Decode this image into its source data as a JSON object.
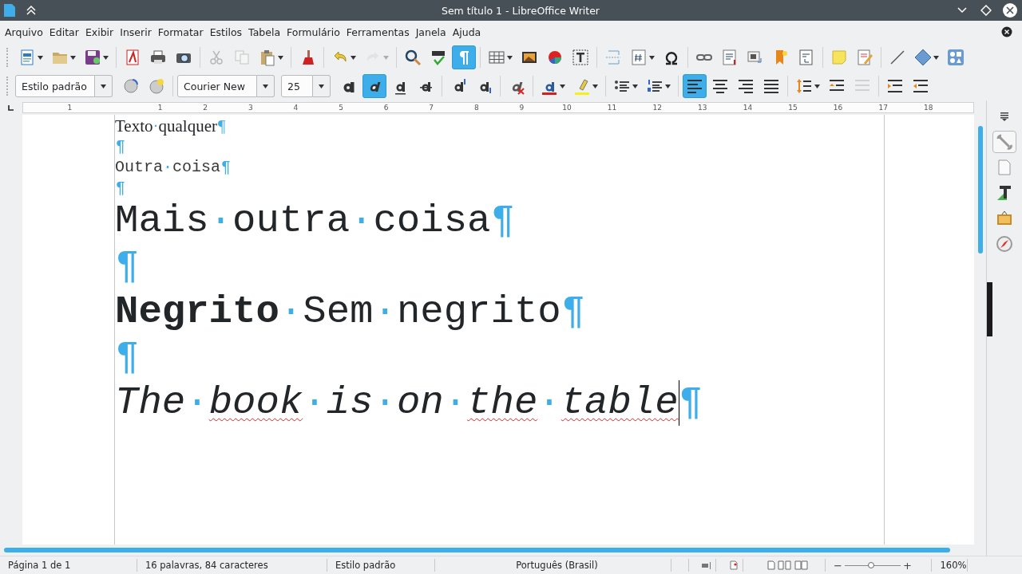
{
  "window": {
    "title": "Sem título 1 - LibreOffice Writer"
  },
  "menu": [
    "Arquivo",
    "Editar",
    "Exibir",
    "Inserir",
    "Formatar",
    "Estilos",
    "Tabela",
    "Formulário",
    "Ferramentas",
    "Janela",
    "Ajuda"
  ],
  "toolbar_standard": [
    {
      "kind": "new",
      "dropdown": true,
      "disabled": false,
      "selected": false
    },
    {
      "kind": "open",
      "dropdown": true,
      "disabled": false,
      "selected": false
    },
    {
      "kind": "save",
      "dropdown": true,
      "disabled": false,
      "selected": false
    },
    {
      "kind": "sep"
    },
    {
      "kind": "pdf",
      "dropdown": false,
      "disabled": false,
      "selected": false
    },
    {
      "kind": "print",
      "dropdown": false,
      "disabled": false,
      "selected": false
    },
    {
      "kind": "preview",
      "dropdown": false,
      "disabled": false,
      "selected": false
    },
    {
      "kind": "sep"
    },
    {
      "kind": "cut",
      "dropdown": false,
      "disabled": true,
      "selected": false
    },
    {
      "kind": "copy",
      "dropdown": false,
      "disabled": true,
      "selected": false
    },
    {
      "kind": "paste",
      "dropdown": true,
      "disabled": false,
      "selected": false
    },
    {
      "kind": "sep"
    },
    {
      "kind": "clone",
      "dropdown": false,
      "disabled": false,
      "selected": false
    },
    {
      "kind": "sep"
    },
    {
      "kind": "undo",
      "dropdown": true,
      "disabled": false,
      "selected": false
    },
    {
      "kind": "redo",
      "dropdown": true,
      "disabled": true,
      "selected": false
    },
    {
      "kind": "sep"
    },
    {
      "kind": "find",
      "dropdown": false,
      "disabled": false,
      "selected": false
    },
    {
      "kind": "spelling",
      "dropdown": false,
      "disabled": false,
      "selected": false
    },
    {
      "kind": "marks",
      "dropdown": false,
      "disabled": false,
      "selected": true
    },
    {
      "kind": "sep"
    },
    {
      "kind": "table",
      "dropdown": true,
      "disabled": false,
      "selected": false
    },
    {
      "kind": "image",
      "dropdown": false,
      "disabled": false,
      "selected": false
    },
    {
      "kind": "chart",
      "dropdown": false,
      "disabled": false,
      "selected": false
    },
    {
      "kind": "textbox",
      "dropdown": false,
      "disabled": false,
      "selected": false
    },
    {
      "kind": "sep"
    },
    {
      "kind": "pagebreak",
      "dropdown": false,
      "disabled": false,
      "selected": false
    },
    {
      "kind": "field",
      "dropdown": true,
      "disabled": false,
      "selected": false
    },
    {
      "kind": "special",
      "dropdown": false,
      "disabled": false,
      "selected": false
    },
    {
      "kind": "sep"
    },
    {
      "kind": "hyperlink",
      "dropdown": false,
      "disabled": false,
      "selected": false
    },
    {
      "kind": "footnote",
      "dropdown": false,
      "disabled": false,
      "selected": false
    },
    {
      "kind": "caption",
      "dropdown": false,
      "disabled": false,
      "selected": false
    },
    {
      "kind": "bookmark",
      "dropdown": false,
      "disabled": false,
      "selected": false
    },
    {
      "kind": "crossref",
      "dropdown": false,
      "disabled": false,
      "selected": false
    },
    {
      "kind": "sep"
    },
    {
      "kind": "comment",
      "dropdown": false,
      "disabled": false,
      "selected": false
    },
    {
      "kind": "track",
      "dropdown": false,
      "disabled": false,
      "selected": false
    },
    {
      "kind": "sep"
    },
    {
      "kind": "line",
      "dropdown": false,
      "disabled": false,
      "selected": false
    },
    {
      "kind": "shape",
      "dropdown": true,
      "disabled": false,
      "selected": false
    },
    {
      "kind": "shapes",
      "dropdown": false,
      "disabled": false,
      "selected": false
    }
  ],
  "paragraph_style": {
    "value": "Estilo padrão"
  },
  "font_name": {
    "value": "Courier New"
  },
  "font_size": {
    "value": "25"
  },
  "toolbar_formatting": [
    {
      "kind": "bold",
      "dropdown": false,
      "disabled": false,
      "selected": false
    },
    {
      "kind": "italic",
      "dropdown": false,
      "disabled": false,
      "selected": true
    },
    {
      "kind": "underline",
      "dropdown": false,
      "disabled": false,
      "selected": false
    },
    {
      "kind": "strike",
      "dropdown": false,
      "disabled": false,
      "selected": false
    },
    {
      "kind": "sep"
    },
    {
      "kind": "superscript",
      "dropdown": false,
      "disabled": false,
      "selected": false
    },
    {
      "kind": "subscript",
      "dropdown": false,
      "disabled": false,
      "selected": false
    },
    {
      "kind": "sep"
    },
    {
      "kind": "clear",
      "dropdown": false,
      "disabled": false,
      "selected": false
    },
    {
      "kind": "sep"
    },
    {
      "kind": "fontcolor",
      "dropdown": true,
      "disabled": false,
      "selected": false
    },
    {
      "kind": "highlight",
      "dropdown": true,
      "disabled": false,
      "selected": false
    },
    {
      "kind": "sep"
    },
    {
      "kind": "bullets",
      "dropdown": true,
      "disabled": false,
      "selected": false
    },
    {
      "kind": "numbering",
      "dropdown": true,
      "disabled": false,
      "selected": false
    },
    {
      "kind": "sep"
    },
    {
      "kind": "left",
      "dropdown": false,
      "disabled": false,
      "selected": true
    },
    {
      "kind": "center",
      "dropdown": false,
      "disabled": false,
      "selected": false
    },
    {
      "kind": "right",
      "dropdown": false,
      "disabled": false,
      "selected": false
    },
    {
      "kind": "justify",
      "dropdown": false,
      "disabled": false,
      "selected": false
    },
    {
      "kind": "sep"
    },
    {
      "kind": "spacing",
      "dropdown": true,
      "disabled": false,
      "selected": false
    },
    {
      "kind": "parainc",
      "dropdown": false,
      "disabled": false,
      "selected": false
    },
    {
      "kind": "paradec",
      "dropdown": false,
      "disabled": true,
      "selected": false
    },
    {
      "kind": "sep"
    },
    {
      "kind": "indentinc",
      "dropdown": false,
      "disabled": false,
      "selected": false
    },
    {
      "kind": "indentdec",
      "dropdown": false,
      "disabled": false,
      "selected": false
    }
  ],
  "ruler": [
    "1",
    "1",
    "2",
    "3",
    "4",
    "5",
    "6",
    "7",
    "8",
    "9",
    "10",
    "11",
    "12",
    "13",
    "14",
    "15",
    "16",
    "17",
    "18"
  ],
  "document": {
    "space_mark": "·",
    "paragraph_mark": "¶",
    "paragraphs": [
      {
        "kind": "serif-small",
        "words": [
          {
            "text": "Texto",
            "bold": false,
            "misspelled": false
          },
          {
            "text": "qualquer",
            "bold": false,
            "misspelled": false
          }
        ],
        "cursor": false
      },
      {
        "kind": "mono-small",
        "cursor": false
      },
      {
        "kind": "mono-small",
        "words": [
          {
            "text": "Outra",
            "bold": false,
            "misspelled": false
          },
          {
            "text": "coisa",
            "bold": false,
            "misspelled": false
          }
        ],
        "cursor": false
      },
      {
        "kind": "mono-small",
        "cursor": false
      },
      {
        "kind": "mono-large",
        "words": [
          {
            "text": "Mais",
            "bold": false,
            "misspelled": false
          },
          {
            "text": "outra",
            "bold": false,
            "misspelled": false
          },
          {
            "text": "coisa",
            "bold": false,
            "misspelled": false
          }
        ],
        "cursor": false
      },
      {
        "kind": "mono-large",
        "cursor": false
      },
      {
        "kind": "mono-large",
        "words": [
          {
            "text": "Negrito",
            "bold": true,
            "misspelled": false
          },
          {
            "text": "Sem",
            "bold": false,
            "misspelled": false
          },
          {
            "text": "negrito",
            "bold": false,
            "misspelled": false
          }
        ],
        "cursor": false
      },
      {
        "kind": "mono-large",
        "cursor": false
      },
      {
        "kind": "mono-large-italic",
        "words": [
          {
            "text": "The",
            "bold": false,
            "misspelled": false
          },
          {
            "text": "book",
            "bold": false,
            "misspelled": true
          },
          {
            "text": "is",
            "bold": false,
            "misspelled": false
          },
          {
            "text": "on",
            "bold": false,
            "misspelled": false
          },
          {
            "text": "the",
            "bold": false,
            "misspelled": true
          },
          {
            "text": "table",
            "bold": false,
            "misspelled": true
          }
        ],
        "cursor": true
      }
    ]
  },
  "sidebar": [
    {
      "kind": "menu",
      "selected": false
    },
    {
      "kind": "properties",
      "selected": true
    },
    {
      "kind": "page",
      "selected": false
    },
    {
      "kind": "styles",
      "selected": false
    },
    {
      "kind": "gallery",
      "selected": false
    },
    {
      "kind": "navigator",
      "selected": false
    }
  ],
  "status_bar": {
    "page": "Página 1 de 1",
    "words": "16 palavras, 84 caracteres",
    "style": "Estilo padrão",
    "language": "Português (Brasil)",
    "zoom_out": "−",
    "zoom_in": "+",
    "zoom": {
      "level": 0.47
    },
    "zoom_reading": "160%"
  }
}
